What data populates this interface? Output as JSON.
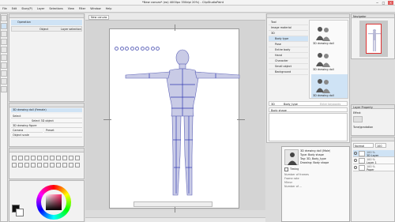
{
  "app": {
    "title": "*New canvas* (ea) 4000px 350dpi 20%) - ClipStudioPaint"
  },
  "menu": [
    "File",
    "Edit",
    "Story(P)",
    "Layer",
    "Selections",
    "View",
    "Filter",
    "Window",
    "Help"
  ],
  "tool_panel": {
    "header": "Operation",
    "columns": [
      "Object",
      "Layer selection"
    ]
  },
  "subtool_panel": {
    "label": "3D drawing doll (Female)"
  },
  "tool_property": {
    "rows": [
      "Select",
      "Select 3D object",
      "3D drawing figure",
      "Camera",
      "Preset",
      "Object scale"
    ]
  },
  "canvas": {
    "tab": "New canvas",
    "figure_label": "3D drawing figure (female)"
  },
  "material_panel": {
    "tree": [
      "Tool",
      "Image material",
      "3D",
      "Body type",
      "Pose",
      "Entire body",
      "Hand",
      "Character",
      "Small object",
      "Background"
    ],
    "tag_label": "3D",
    "tag_value": "Body_type",
    "search_placeholder": "Enter keywords",
    "caption": "Body shape",
    "thumbs": [
      "3D drawing doll",
      "3D drawing doll",
      "3D drawing doll"
    ]
  },
  "navigator": {
    "label": "Navigator"
  },
  "layer_property": {
    "label": "Layer Property",
    "effect": "Effect",
    "tone": "Tone/gradation"
  },
  "info_popup": {
    "lines": [
      "3D drawing doll (Male)",
      "Type: Body shape",
      "Tag: 3D, Body_type",
      "Drawing: Body shape"
    ],
    "timing": "Timing",
    "fields": [
      "Number of frames",
      "Frame rate",
      "Mirror",
      "Number of ..."
    ]
  },
  "layers": {
    "blend": "Normal",
    "opacity": "100",
    "items": [
      {
        "pct": "100 %",
        "name": "3D Layer",
        "selected": true
      },
      {
        "pct": "100 %",
        "name": "Layer 1",
        "selected": false
      },
      {
        "pct": "100 %",
        "name": "Paper",
        "selected": false
      }
    ]
  },
  "colors": {
    "main": "#111111",
    "sub": "#ffffff",
    "accent": "#2f7ad2",
    "selection": "#cfe3f5"
  }
}
